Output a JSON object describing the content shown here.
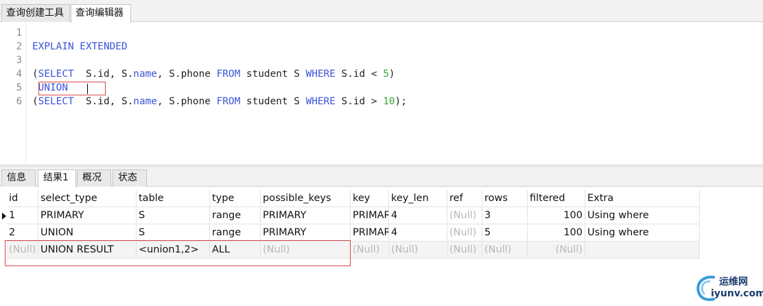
{
  "editor_tabs": [
    {
      "label": "查询创建工具"
    },
    {
      "label": "查询编辑器"
    }
  ],
  "editor": {
    "line_numbers": [
      "1",
      "2",
      "3",
      "4",
      "5",
      "6"
    ],
    "line2": "EXPLAIN EXTENDED",
    "line4": {
      "open_paren": "(",
      "select": "SELECT",
      "cols_a": "  S.id, S.",
      "name": "name",
      "cols_b": ", S.phone ",
      "from": "FROM",
      "table": " student S ",
      "where": "WHERE",
      "cond": " S.id < ",
      "value": "5",
      "close": ")"
    },
    "line5": " UNION",
    "line6": {
      "open_paren": "(",
      "select": "SELECT",
      "cols_a": "  S.id, S.",
      "name": "name",
      "cols_b": ", S.phone ",
      "from": "FROM",
      "table": " student S ",
      "where": "WHERE",
      "cond": " S.id > ",
      "value": "10",
      "close": ");"
    }
  },
  "result_tabs": [
    {
      "label": "信息"
    },
    {
      "label": "结果1"
    },
    {
      "label": "概况"
    },
    {
      "label": "状态"
    }
  ],
  "grid": {
    "columns": [
      "id",
      "select_type",
      "table",
      "type",
      "possible_keys",
      "key",
      "key_len",
      "ref",
      "rows",
      "filtered",
      "Extra"
    ],
    "rows": [
      [
        "1",
        "PRIMARY",
        "S",
        "range",
        "PRIMARY",
        "PRIMARY",
        "4",
        "(Null)",
        "3",
        "100",
        "Using where"
      ],
      [
        "2",
        "UNION",
        "S",
        "range",
        "PRIMARY",
        "PRIMARY",
        "4",
        "(Null)",
        "5",
        "100",
        "Using where"
      ],
      [
        "(Null)",
        "UNION RESULT",
        "<union1,2>",
        "ALL",
        "(Null)",
        "(Null)",
        "(Null)",
        "(Null)",
        "(Null)",
        "(Null)",
        ""
      ]
    ]
  },
  "watermark": {
    "line1": "运维网",
    "line2": "iyunv.com"
  },
  "colors": {
    "keyword": "#3b54d9",
    "number": "#36a336",
    "highlight_box": "#d94848",
    "null": "#b7b7b7"
  }
}
